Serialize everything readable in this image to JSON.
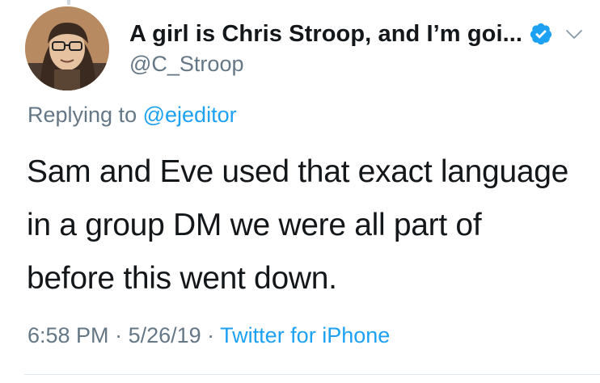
{
  "tweet": {
    "display_name": "A girl is Chris Stroop, and I’m goi...",
    "handle": "@C_Stroop",
    "replying_prefix": "Replying to",
    "replying_to": "@ejeditor",
    "text": "Sam and Eve used that exact language in a group DM we were all part of before this went down.",
    "time": "6:58 PM",
    "date": "5/26/19",
    "separator": " · ",
    "source": "Twitter for iPhone"
  },
  "icons": {
    "verified": "verified-badge-icon",
    "more": "chevron-down-icon"
  },
  "colors": {
    "accent": "#1da1f2",
    "text": "#14171a",
    "muted": "#657786"
  }
}
